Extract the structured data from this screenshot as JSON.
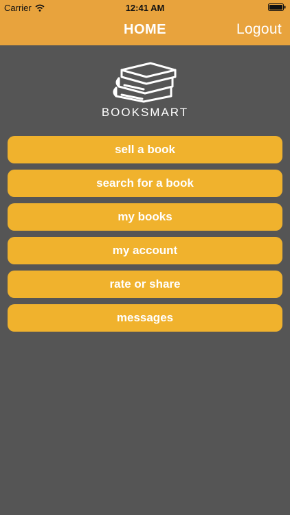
{
  "status_bar": {
    "carrier": "Carrier",
    "time": "12:41 AM",
    "wifi_icon": "wifi-icon",
    "battery_icon": "battery-icon"
  },
  "nav": {
    "title": "HOME",
    "logout_label": "Logout"
  },
  "logo": {
    "icon": "books-icon",
    "brand_name": "BOOKSMART"
  },
  "menu": {
    "items": [
      {
        "label": "sell a book"
      },
      {
        "label": "search for a book"
      },
      {
        "label": "my books"
      },
      {
        "label": "my account"
      },
      {
        "label": "rate or share"
      },
      {
        "label": "messages"
      }
    ]
  },
  "colors": {
    "header": "#e8a33d",
    "button": "#f0b22d",
    "background": "#555555",
    "text": "#ffffff"
  }
}
